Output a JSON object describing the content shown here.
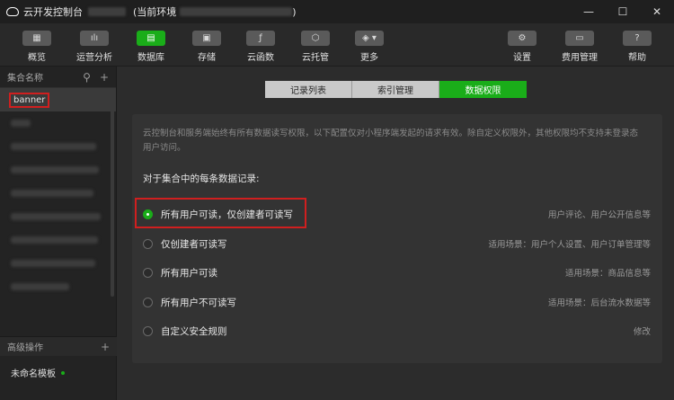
{
  "titlebar": {
    "app_title": "云开发控制台",
    "env_label": "(当前环境",
    "env_close": ")"
  },
  "window_controls": {
    "minimize": "—",
    "maximize": "☐",
    "close": "✕"
  },
  "toolbar": {
    "items": [
      {
        "label": "概览",
        "icon": "grid-icon",
        "glyph": "▦"
      },
      {
        "label": "运营分析",
        "icon": "bar-chart-icon",
        "glyph": "ılı"
      },
      {
        "label": "数据库",
        "icon": "database-icon",
        "glyph": "▤"
      },
      {
        "label": "存储",
        "icon": "storage-icon",
        "glyph": "▣"
      },
      {
        "label": "云函数",
        "icon": "function-icon",
        "glyph": "ƒ"
      },
      {
        "label": "云托管",
        "icon": "cube-icon",
        "glyph": "⬡"
      },
      {
        "label": "更多",
        "icon": "layers-icon",
        "glyph": "◈ ▾"
      },
      {
        "label": "设置",
        "icon": "gear-icon",
        "glyph": "⚙"
      },
      {
        "label": "费用管理",
        "icon": "billing-icon",
        "glyph": "▭"
      },
      {
        "label": "帮助",
        "icon": "help-icon",
        "glyph": "?"
      }
    ],
    "active": "数据库"
  },
  "sidebar": {
    "header": "集合名称",
    "search_icon": "search-icon",
    "add_icon": "plus-icon",
    "collections": [
      "banner"
    ],
    "advanced_header": "高级操作",
    "template_item": "未命名模板"
  },
  "tabs": [
    {
      "label": "记录列表",
      "active": false
    },
    {
      "label": "索引管理",
      "active": false
    },
    {
      "label": "数据权限",
      "active": true
    }
  ],
  "permissions": {
    "description": "云控制台和服务端始终有所有数据读写权限，以下配置仅对小程序端发起的请求有效。除自定义权限外，其他权限均不支持未登录态用户访问。",
    "section_title": "对于集合中的每条数据记录:",
    "options": [
      {
        "label": "所有用户可读，仅创建者可读写",
        "hint": "用户评论、用户公开信息等",
        "selected": true
      },
      {
        "label": "仅创建者可读写",
        "hint": "适用场景：用户个人设置、用户订单管理等",
        "selected": false
      },
      {
        "label": "所有用户可读",
        "hint": "适用场景：商品信息等",
        "selected": false
      },
      {
        "label": "所有用户不可读写",
        "hint": "适用场景：后台流水数据等",
        "selected": false
      },
      {
        "label": "自定义安全规则",
        "hint": "修改",
        "selected": false
      }
    ]
  },
  "colors": {
    "accent": "#1aad19",
    "highlight": "#d01f1f"
  }
}
